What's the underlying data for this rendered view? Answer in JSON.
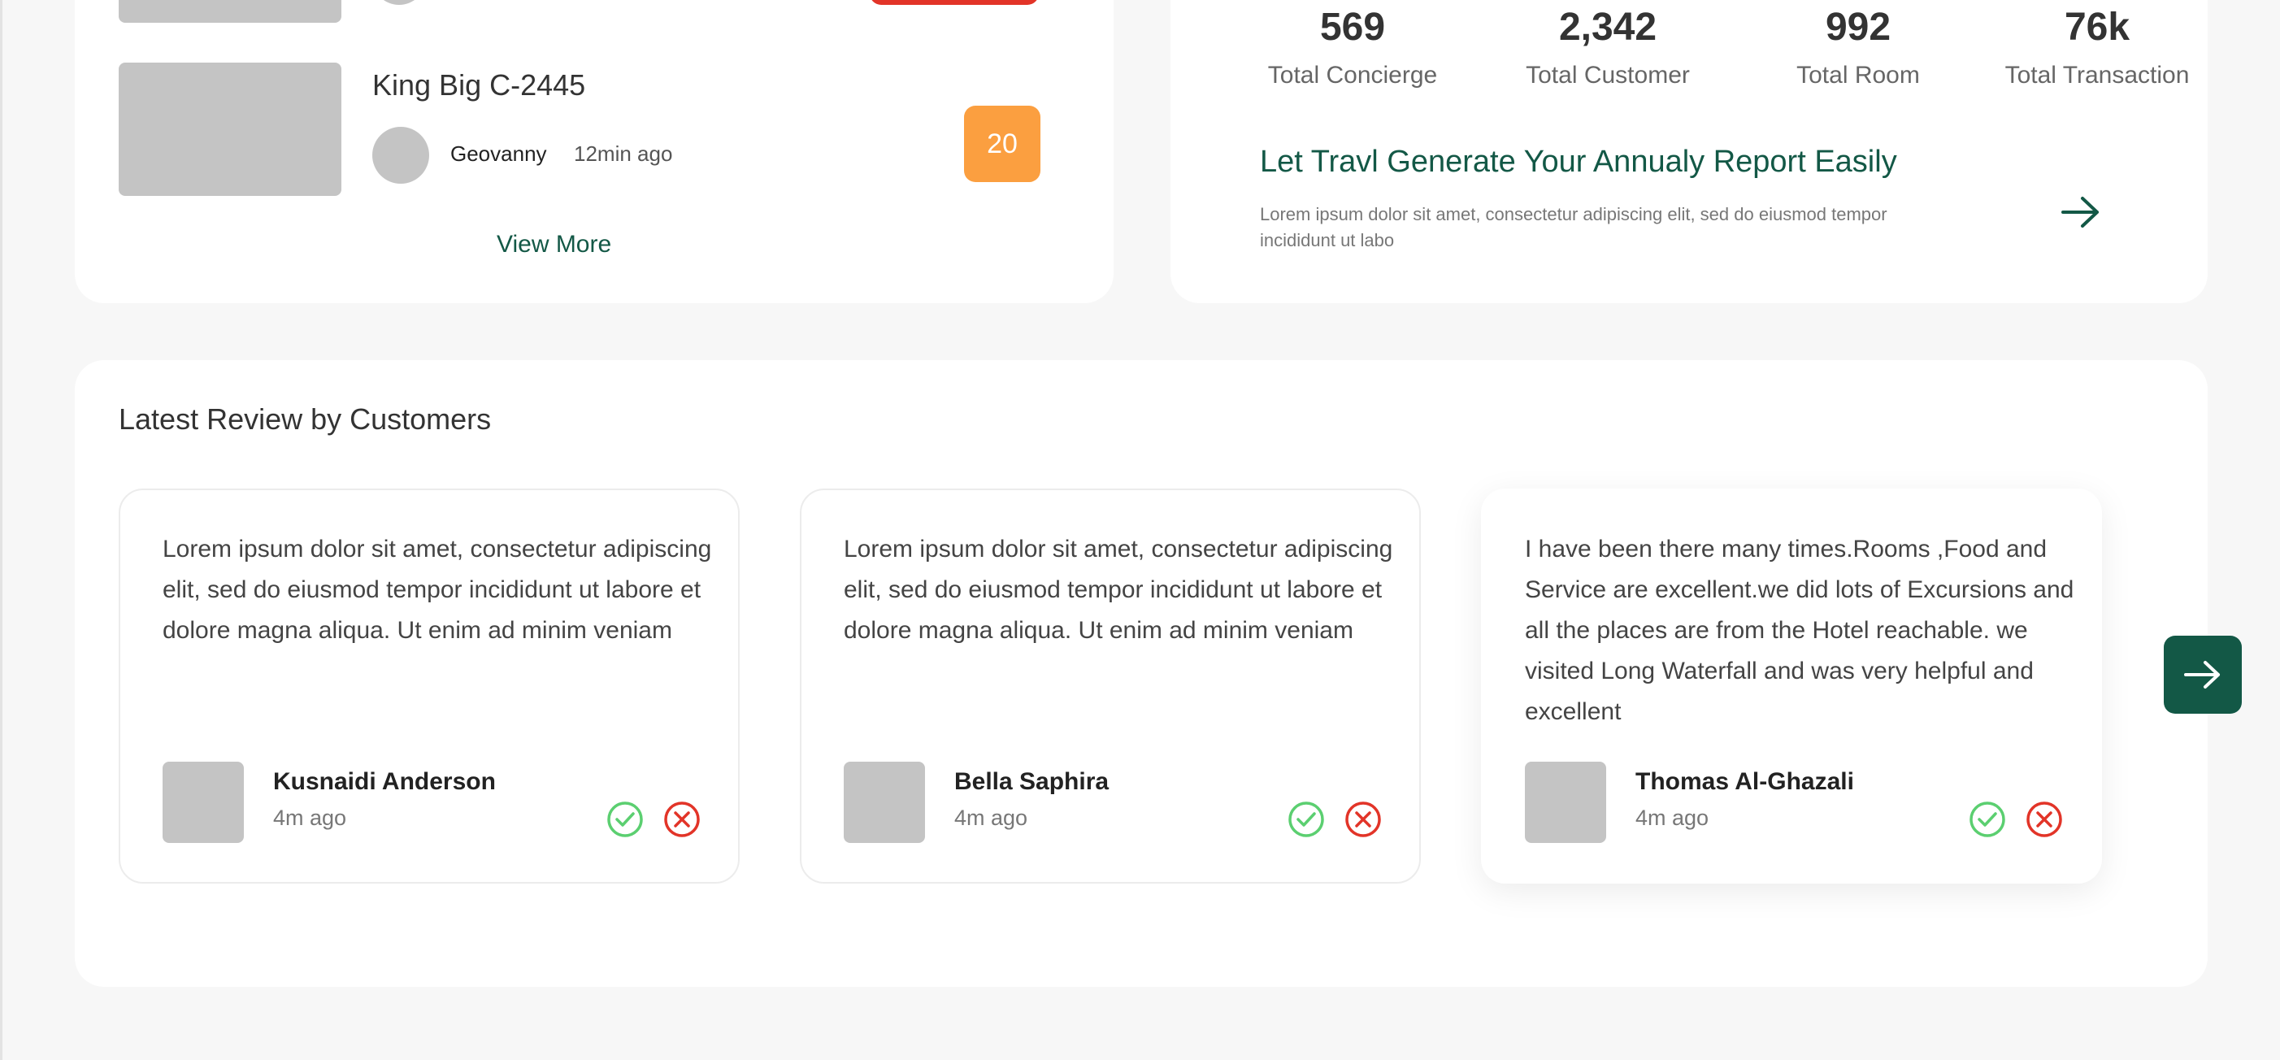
{
  "booking_list": {
    "item": {
      "room": "King Big C-2445",
      "guest": "Geovanny",
      "time": "12min ago",
      "count": "20"
    },
    "view_more": "View More"
  },
  "stats": [
    {
      "value": "569",
      "label": "Total Concierge"
    },
    {
      "value": "2,342",
      "label": "Total Customer"
    },
    {
      "value": "992",
      "label": "Total Room"
    },
    {
      "value": "76k",
      "label": "Total Transaction"
    }
  ],
  "report": {
    "title": "Let Travl Generate Your Annualy Report Easily",
    "description": "Lorem ipsum dolor sit amet, consectetur adipiscing elit, sed do eiusmod tempor incididunt ut labo"
  },
  "reviews": {
    "title": "Latest Review by Customers",
    "items": [
      {
        "text": "Lorem ipsum dolor sit amet, consectetur adipiscing elit, sed do eiusmod tempor incididunt ut labore et dolore magna aliqua. Ut enim ad minim veniam",
        "name": "Kusnaidi Anderson",
        "time": "4m ago"
      },
      {
        "text": "Lorem ipsum dolor sit amet, consectetur adipiscing elit, sed do eiusmod tempor incididunt ut labore et dolore magna aliqua. Ut enim ad minim veniam",
        "name": "Bella Saphira",
        "time": "4m ago"
      },
      {
        "text": "I have been there many times.Rooms ,Food and Service are excellent.we did lots of Excursions and all the places are from the Hotel reachable. we visited Long Waterfall and was very helpful and excellent",
        "name": "Thomas Al-Ghazali",
        "time": "4m ago"
      }
    ]
  },
  "colors": {
    "brand_green": "#135846",
    "badge_orange": "#FB9F40",
    "badge_red": "#E23428",
    "approve_green": "#5BCF70",
    "reject_red": "#E23428",
    "placeholder_gray": "#C4C4C4"
  },
  "icons": {
    "report_arrow": "arrow-right-icon",
    "approve": "check-circle-icon",
    "reject": "x-circle-icon",
    "next": "arrow-right-icon"
  }
}
